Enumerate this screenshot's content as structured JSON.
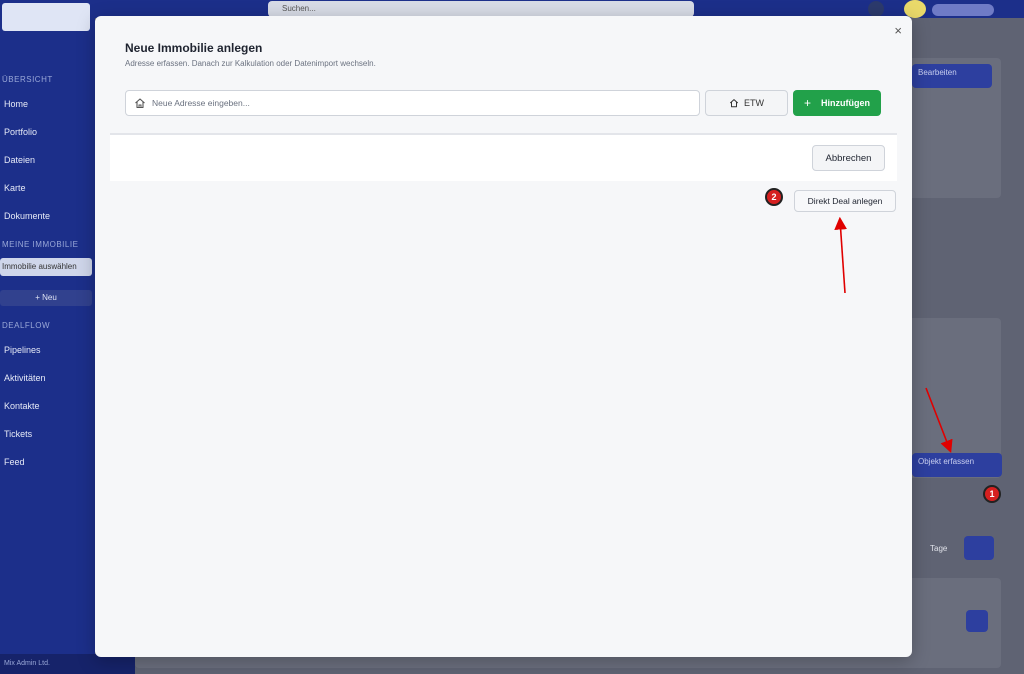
{
  "background": {
    "search_placeholder": "Suchen...",
    "sidebar": {
      "section_1": "ÜBERSICHT",
      "items_1": [
        "Home",
        "Portfolio",
        "Dateien",
        "Karte",
        "Dokumente"
      ],
      "section_2": "MEINE IMMOBILIE",
      "select_value": "Immobilie auswählen",
      "new_button": "+ Neu",
      "section_3": "DEALFLOW",
      "items_2": [
        "Pipelines",
        "Aktivitäten",
        "Kontakte",
        "Tickets",
        "Feed"
      ],
      "footer_user": "Mix Admin Ltd."
    },
    "bg_button_top": "Bearbeiten",
    "bg_button_objects": "Objekt erfassen",
    "bg_pager_prev": "‹",
    "bg_pager_label": "Tage"
  },
  "modal": {
    "title": "Neue Immobilie anlegen",
    "subtitle": "Adresse erfassen. Danach zur Kalkulation oder Datenimport wechseln.",
    "address_placeholder": "Neue Adresse eingeben...",
    "etw_label": "ETW",
    "add_label": "Hinzufügen",
    "cancel_label": "Abbrechen",
    "deal_label": "Direkt Deal anlegen",
    "close_glyph": "×"
  },
  "annotations": {
    "badge_1": "1",
    "badge_2": "2",
    "arrow_color": "#e00000"
  },
  "colors": {
    "primary": "#1c2f8a",
    "success": "#22a14a",
    "badge": "#d62020"
  }
}
